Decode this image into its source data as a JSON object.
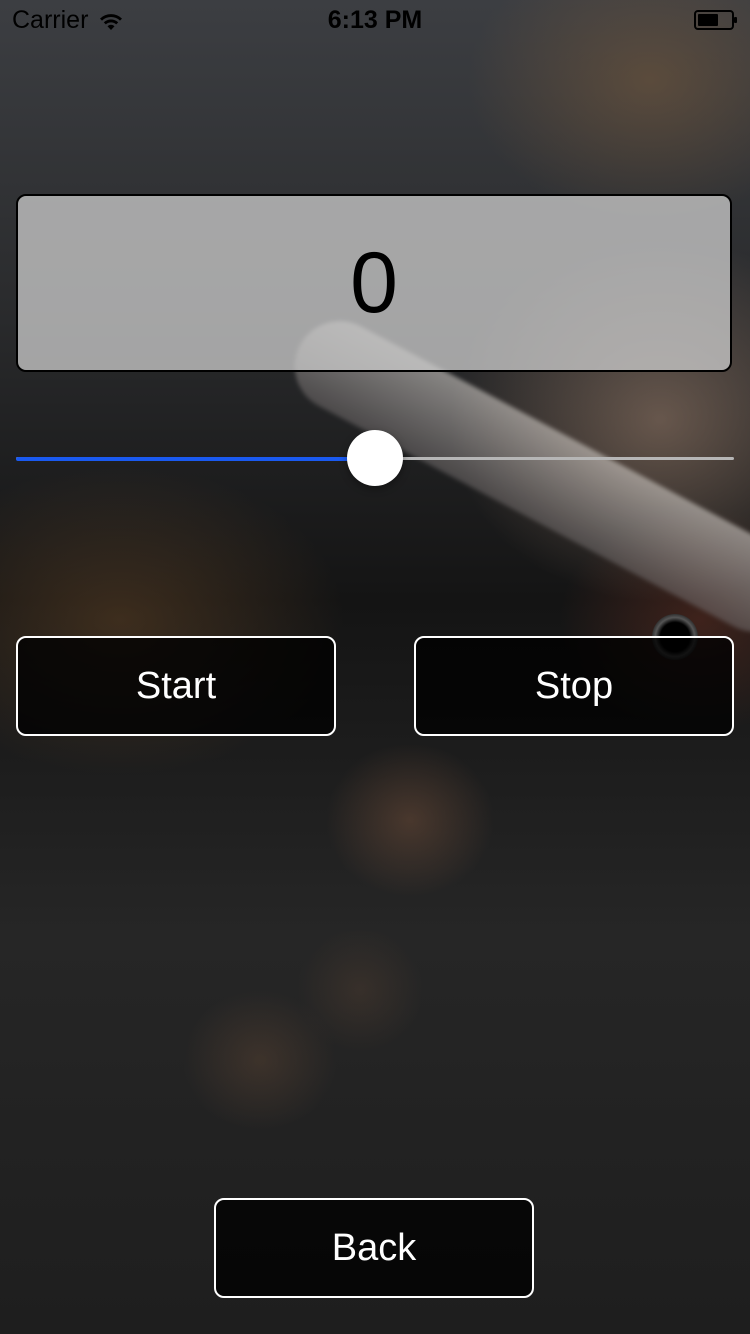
{
  "status_bar": {
    "carrier": "Carrier",
    "time": "6:13 PM",
    "wifi_icon": "wifi-icon",
    "battery_icon": "battery-icon"
  },
  "counter": {
    "value": "0"
  },
  "slider": {
    "value_fraction": 0.5,
    "min_track_color": "#1a5af0",
    "max_track_color": "#b6b6b6"
  },
  "buttons": {
    "start_label": "Start",
    "stop_label": "Stop",
    "back_label": "Back"
  }
}
